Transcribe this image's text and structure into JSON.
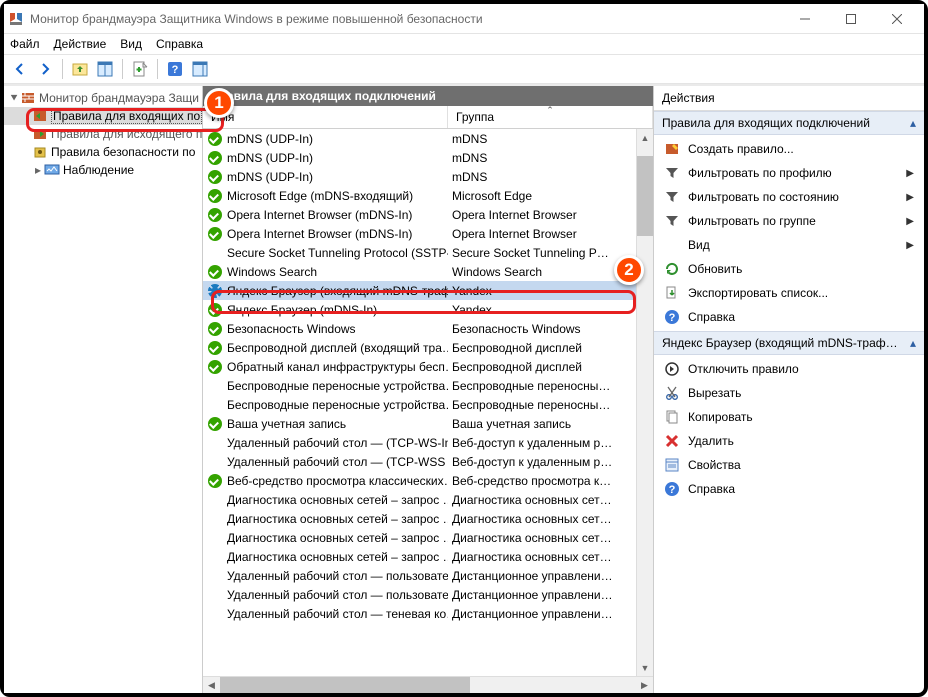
{
  "window": {
    "title": "Монитор брандмауэра Защитника Windows в режиме повышенной безопасности"
  },
  "menu": {
    "file": "Файл",
    "action": "Действие",
    "view": "Вид",
    "help": "Справка"
  },
  "tree": {
    "root": "Монитор брандмауэра Защи",
    "inbound": "Правила для входящих по",
    "outbound": "Правила для исходящего п",
    "security": "Правила безопасности по",
    "monitoring": "Наблюдение"
  },
  "center": {
    "title": "Правила для входящих подключений",
    "col_name": "Имя",
    "col_group": "Группа"
  },
  "rules": [
    {
      "icon": "check",
      "name": "mDNS (UDP-In)",
      "group": "mDNS"
    },
    {
      "icon": "check",
      "name": "mDNS (UDP-In)",
      "group": "mDNS"
    },
    {
      "icon": "check",
      "name": "mDNS (UDP-In)",
      "group": "mDNS"
    },
    {
      "icon": "check",
      "name": "Microsoft Edge (mDNS-входящий)",
      "group": "Microsoft Edge"
    },
    {
      "icon": "check",
      "name": "Opera Internet Browser (mDNS-In)",
      "group": "Opera Internet Browser"
    },
    {
      "icon": "check",
      "name": "Opera Internet Browser (mDNS-In)",
      "group": "Opera Internet Browser"
    },
    {
      "icon": "none",
      "name": "Secure Socket Tunneling Protocol (SSTP-…",
      "group": "Secure Socket Tunneling P…"
    },
    {
      "icon": "check",
      "name": "Windows Search",
      "group": "Windows Search"
    },
    {
      "icon": "gear",
      "name": "Яндекс Браузер (входящий mDNS-траф…",
      "group": "Yandex",
      "selected": true
    },
    {
      "icon": "check",
      "name": "Яндекс.Браузер (mDNS-In)",
      "group": "Yandex"
    },
    {
      "icon": "check",
      "name": "Безопасность Windows",
      "group": "Безопасность Windows"
    },
    {
      "icon": "check",
      "name": "Беспроводной дисплей (входящий тра…",
      "group": "Беспроводной дисплей"
    },
    {
      "icon": "check",
      "name": "Обратный канал инфраструктуры бесп…",
      "group": "Беспроводной дисплей"
    },
    {
      "icon": "none",
      "name": "Беспроводные переносные устройства…",
      "group": "Беспроводные переносны…"
    },
    {
      "icon": "none",
      "name": "Беспроводные переносные устройства…",
      "group": "Беспроводные переносны…"
    },
    {
      "icon": "check",
      "name": "Ваша учетная запись",
      "group": "Ваша учетная запись"
    },
    {
      "icon": "none",
      "name": "Удаленный рабочий стол — (TCP-WS-In)",
      "group": "Веб-доступ к удаленным р…"
    },
    {
      "icon": "none",
      "name": "Удаленный рабочий стол — (TCP-WSS …",
      "group": "Веб-доступ к удаленным р…"
    },
    {
      "icon": "check",
      "name": "Веб-средство просмотра классических…",
      "group": "Веб-средство просмотра к…"
    },
    {
      "icon": "none",
      "name": "Диагностика основных сетей – запрос …",
      "group": "Диагностика основных сет…"
    },
    {
      "icon": "none",
      "name": "Диагностика основных сетей – запрос …",
      "group": "Диагностика основных сет…"
    },
    {
      "icon": "none",
      "name": "Диагностика основных сетей – запрос …",
      "group": "Диагностика основных сет…"
    },
    {
      "icon": "none",
      "name": "Диагностика основных сетей – запрос …",
      "group": "Диагностика основных сет…"
    },
    {
      "icon": "none",
      "name": "Удаленный рабочий стол — пользовате…",
      "group": "Дистанционное управлени…"
    },
    {
      "icon": "none",
      "name": "Удаленный рабочий стол — пользовате…",
      "group": "Дистанционное управлени…"
    },
    {
      "icon": "none",
      "name": "Удаленный рабочий стол — теневая ко…",
      "group": "Дистанционное управлени…"
    }
  ],
  "actions": {
    "title": "Действия",
    "header1": "Правила для входящих подключений",
    "items1": [
      {
        "icon": "new",
        "label": "Создать правило..."
      },
      {
        "icon": "filter",
        "label": "Фильтровать по профилю",
        "sub": true
      },
      {
        "icon": "filter",
        "label": "Фильтровать по состоянию",
        "sub": true
      },
      {
        "icon": "filter",
        "label": "Фильтровать по группе",
        "sub": true
      },
      {
        "icon": "view",
        "label": "Вид",
        "sub": true
      },
      {
        "icon": "refresh",
        "label": "Обновить"
      },
      {
        "icon": "export",
        "label": "Экспортировать список..."
      },
      {
        "icon": "help",
        "label": "Справка"
      }
    ],
    "header2": "Яндекс Браузер (входящий mDNS-траф…",
    "items2": [
      {
        "icon": "disable",
        "label": "Отключить правило"
      },
      {
        "icon": "cut",
        "label": "Вырезать"
      },
      {
        "icon": "copy",
        "label": "Копировать"
      },
      {
        "icon": "delete",
        "label": "Удалить"
      },
      {
        "icon": "props",
        "label": "Свойства"
      },
      {
        "icon": "help",
        "label": "Справка"
      }
    ]
  },
  "callouts": {
    "c1": "1",
    "c2": "2"
  }
}
